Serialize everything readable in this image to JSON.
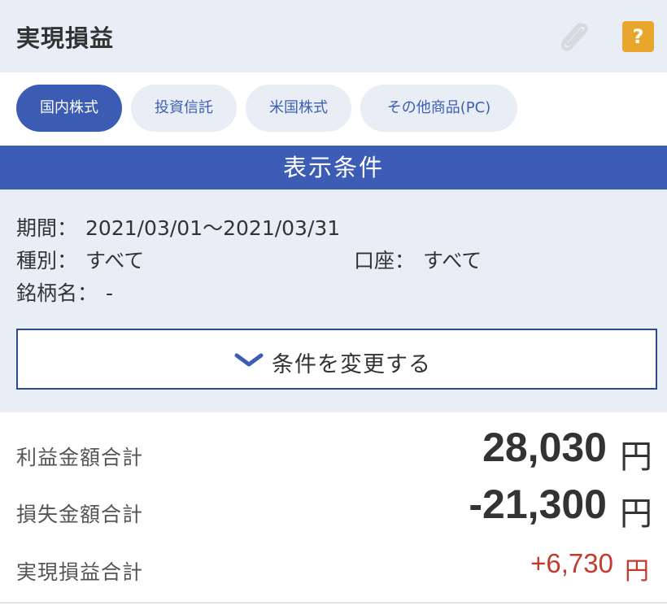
{
  "header": {
    "title": "実現損益",
    "clip_icon": "paperclip-icon",
    "help_label": "?",
    "help_color": "#e8a72c"
  },
  "tabs": [
    {
      "label": "国内株式",
      "active": true
    },
    {
      "label": "投資信託",
      "active": false
    },
    {
      "label": "米国株式",
      "active": false
    },
    {
      "label": "その他商品(PC)",
      "active": false
    }
  ],
  "conditions": {
    "bar_title": "表示条件",
    "period_label": "期間：",
    "period_value": "2021/03/01〜2021/03/31",
    "type_label": "種別：",
    "type_value": "すべて",
    "account_label": "口座：",
    "account_value": "すべて",
    "name_label": "銘柄名：",
    "name_value": "-",
    "change_button_label": "条件を変更する",
    "change_button_icon": "chevron-down-icon"
  },
  "summary": {
    "profit_label": "利益金額合計",
    "profit_value": "28,030",
    "loss_label": "損失金額合計",
    "loss_value": "-21,300",
    "net_label": "実現損益合計",
    "net_value": "+6,730",
    "unit": "円"
  },
  "colors": {
    "accent": "#3d5cb5",
    "panel_bg": "#e9eef6",
    "positive": "#c23b2e",
    "help": "#e8a72c"
  }
}
